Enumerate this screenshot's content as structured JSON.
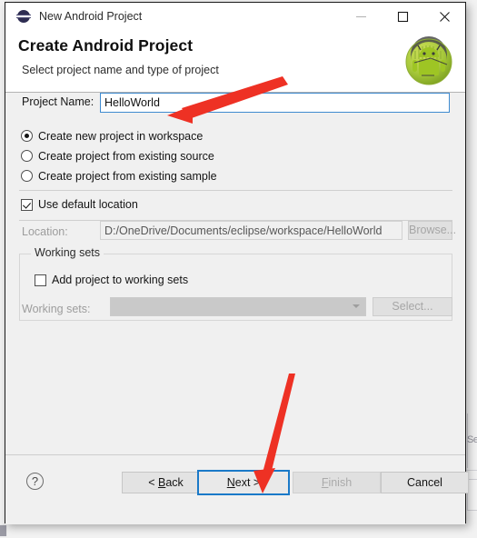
{
  "window": {
    "title": "New Android Project",
    "icon": "eclipse-icon",
    "controls": {
      "minimize": "minimize-icon",
      "maximize": "maximize-icon",
      "close": "close-icon"
    }
  },
  "header": {
    "title": "Create Android Project",
    "subtitle": "Select project name and type of project",
    "logo": "android-robot-icon"
  },
  "form": {
    "project_name": {
      "label": "Project Name:",
      "value": "HelloWorld",
      "placeholder": ""
    },
    "project_source_options": [
      {
        "label": "Create new project in workspace",
        "selected": true
      },
      {
        "label": "Create project from existing source",
        "selected": false
      },
      {
        "label": "Create project from existing sample",
        "selected": false
      }
    ],
    "use_default_location": {
      "label": "Use default location",
      "checked": true
    },
    "location": {
      "label": "Location:",
      "value": "D:/OneDrive/Documents/eclipse/workspace/HelloWorld",
      "browse_label": "Browse...",
      "disabled": true
    },
    "working_sets": {
      "group_label": "Working sets",
      "add_checkbox": {
        "label": "Add project to working sets",
        "checked": false
      },
      "combo_label": "Working sets:",
      "combo_value": "",
      "select_label": "Select...",
      "disabled": true
    }
  },
  "footer": {
    "help": "?",
    "buttons": [
      {
        "name": "back",
        "label": "< Back",
        "enabled": true,
        "default": false
      },
      {
        "name": "next",
        "label": "Next >",
        "enabled": true,
        "default": true
      },
      {
        "name": "finish",
        "label": "Finish",
        "enabled": false,
        "default": false
      },
      {
        "name": "cancel",
        "label": "Cancel",
        "enabled": true,
        "default": false
      }
    ]
  },
  "background": {
    "ghost_text": "Se"
  },
  "colors": {
    "accent_focus": "#3f8bd0",
    "default_button_border": "#1a79c8",
    "annotation_red": "#ee3124",
    "dialog_bg": "#f0f0f0",
    "header_bg": "#ffffff",
    "android_green": "#a4c639"
  }
}
